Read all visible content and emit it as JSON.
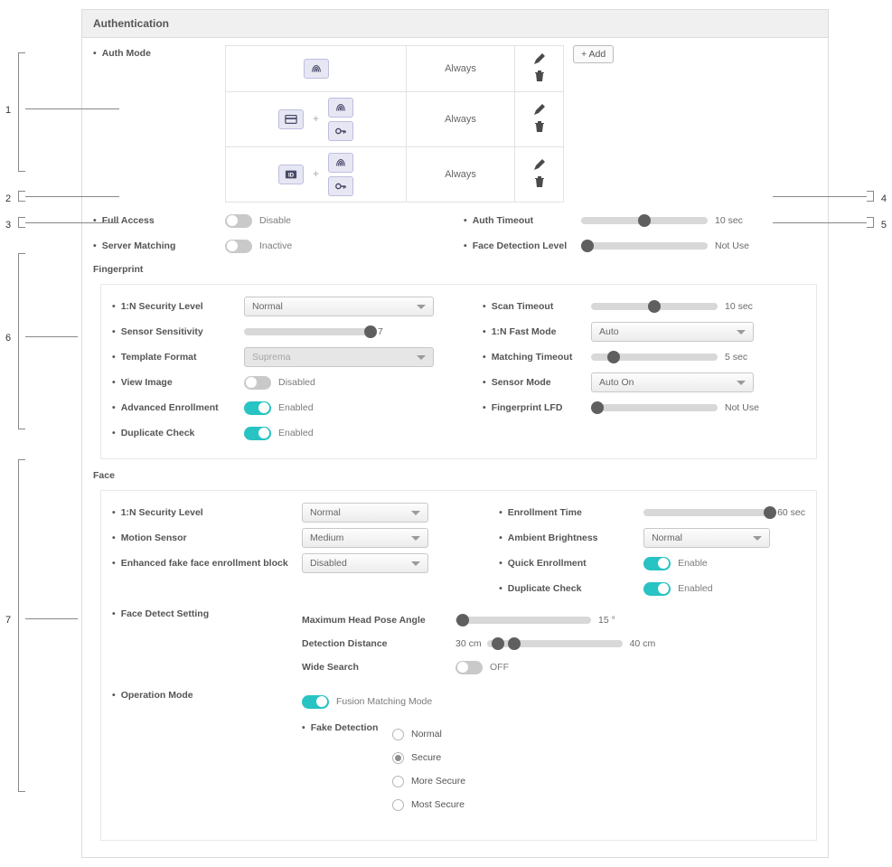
{
  "header": {
    "title": "Authentication"
  },
  "callouts": {
    "c1": "1",
    "c2": "2",
    "c3": "3",
    "c4": "4",
    "c5": "5",
    "c6": "6",
    "c7": "7"
  },
  "auth_mode": {
    "label": "Auth Mode",
    "add_button": "+ Add",
    "rows": [
      {
        "schedule": "Always"
      },
      {
        "schedule": "Always"
      },
      {
        "schedule": "Always"
      }
    ]
  },
  "main": {
    "full_access": {
      "label": "Full Access",
      "state": "Disable"
    },
    "server_matching": {
      "label": "Server Matching",
      "state": "Inactive"
    },
    "auth_timeout": {
      "label": "Auth Timeout",
      "value": "10 sec"
    },
    "face_detection_level": {
      "label": "Face Detection Level",
      "value": "Not Use"
    }
  },
  "fingerprint": {
    "title": "Fingerprint",
    "sec_level": {
      "label": "1:N Security Level",
      "value": "Normal"
    },
    "sensitivity": {
      "label": "Sensor Sensitivity",
      "value": "7"
    },
    "template_format": {
      "label": "Template Format",
      "value": "Suprema"
    },
    "view_image": {
      "label": "View Image",
      "state": "Disabled"
    },
    "adv_enroll": {
      "label": "Advanced Enrollment",
      "state": "Enabled"
    },
    "dup_check": {
      "label": "Duplicate Check",
      "state": "Enabled"
    },
    "scan_timeout": {
      "label": "Scan Timeout",
      "value": "10 sec"
    },
    "fast_mode": {
      "label": "1:N Fast Mode",
      "value": "Auto"
    },
    "match_timeout": {
      "label": "Matching Timeout",
      "value": "5 sec"
    },
    "sensor_mode": {
      "label": "Sensor Mode",
      "value": "Auto On"
    },
    "lfd": {
      "label": "Fingerprint LFD",
      "value": "Not Use"
    }
  },
  "face": {
    "title": "Face",
    "sec_level": {
      "label": "1:N Security Level",
      "value": "Normal"
    },
    "motion": {
      "label": "Motion Sensor",
      "value": "Medium"
    },
    "fake_block": {
      "label": "Enhanced fake face enrollment block",
      "value": "Disabled"
    },
    "enroll_time": {
      "label": "Enrollment Time",
      "value": "60 sec"
    },
    "ambient": {
      "label": "Ambient Brightness",
      "value": "Normal"
    },
    "quick_enroll": {
      "label": "Quick Enrollment",
      "state": "Enable"
    },
    "dup_check": {
      "label": "Duplicate Check",
      "state": "Enabled"
    },
    "detect_setting": {
      "label": "Face Detect Setting",
      "max_angle": {
        "label": "Maximum Head Pose Angle",
        "value": "15 °"
      },
      "distance": {
        "label": "Detection Distance",
        "low": "30 cm",
        "high": "40 cm"
      },
      "wide": {
        "label": "Wide Search",
        "state": "OFF"
      }
    },
    "op_mode": {
      "label": "Operation Mode",
      "fusion": "Fusion Matching Mode",
      "fake_detection": {
        "label": "Fake Detection",
        "options": [
          "Normal",
          "Secure",
          "More Secure",
          "Most Secure"
        ],
        "selected": 1
      }
    }
  }
}
